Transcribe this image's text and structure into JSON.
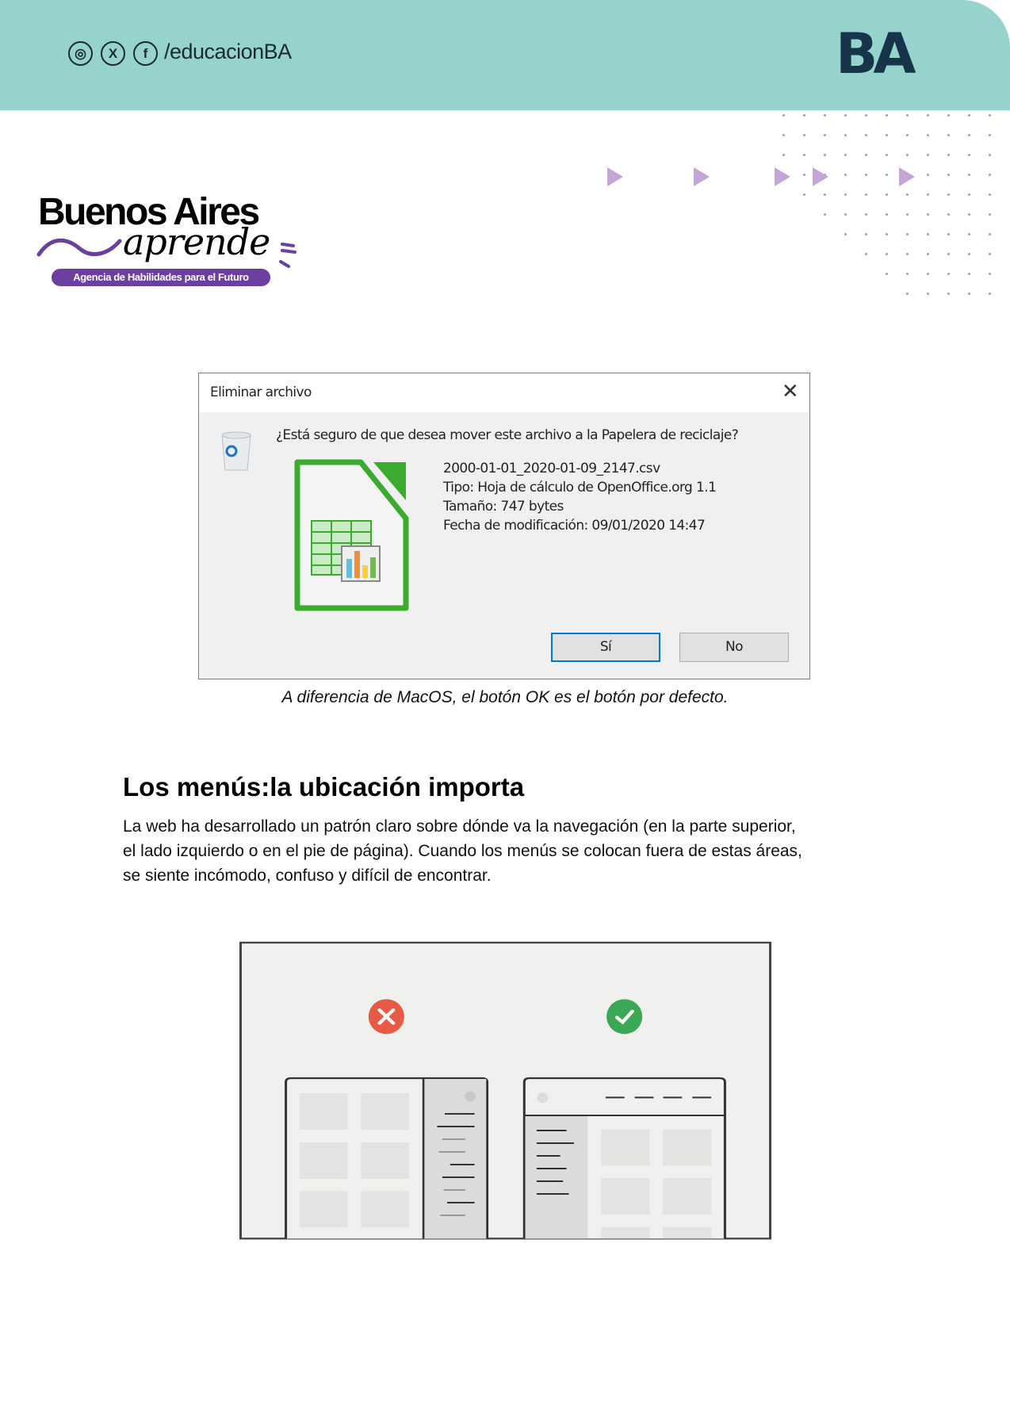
{
  "header": {
    "social_icons": [
      "instagram-icon",
      "x-icon",
      "facebook-icon"
    ],
    "handle": "/educacionBA",
    "brand_logo": "BA",
    "background_color": "#97d3cd"
  },
  "logo": {
    "title": "Buenos Aires",
    "script": "aprende",
    "tagline": "Agencia de Habilidades para el Futuro",
    "accent_color": "#6a3fa0"
  },
  "dialog": {
    "title": "Eliminar archivo",
    "question": "¿Está seguro de que desea mover este archivo a la Papelera de reciclaje?",
    "details": [
      "2000-01-01_2020-01-09_2147.csv",
      "Tipo: Hoja de cálculo de OpenOffice.org 1.1",
      "Tamaño: 747 bytes",
      "Fecha de modificación: 09/01/2020 14:47"
    ],
    "yes_label": "Sí",
    "no_label": "No"
  },
  "caption": "A diferencia de MacOS, el botón OK es el botón por defecto.",
  "section": {
    "heading": "Los menús:la ubicación importa",
    "paragraph_lines": [
      "La web ha desarrollado un patrón claro sobre dónde va la navegación (en la parte superior,",
      "el lado izquierdo o en el pie de página). Cuando los menús se colocan fuera de estas áreas,",
      "se siente incómodo, confuso y difícil de encontrar."
    ]
  },
  "illustration": {
    "bad_color": "#e65a46",
    "good_color": "#3aa854"
  }
}
